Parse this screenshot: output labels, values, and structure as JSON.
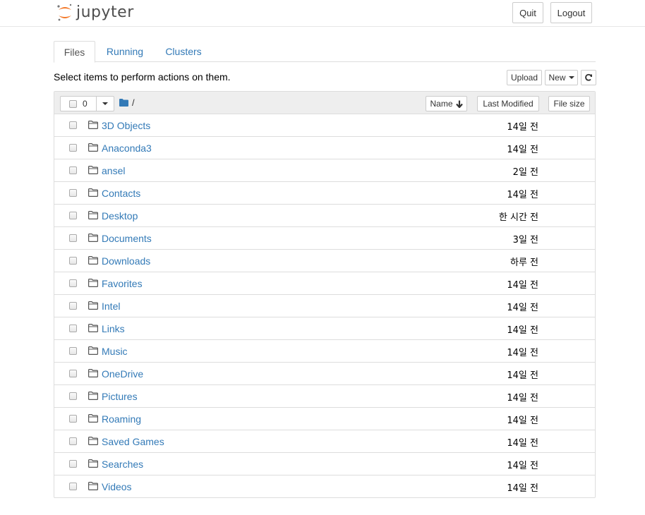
{
  "header": {
    "logo_text": "jupyter",
    "quit_label": "Quit",
    "logout_label": "Logout",
    "accent_color": "#f37726"
  },
  "tabs": [
    {
      "label": "Files",
      "active": true
    },
    {
      "label": "Running",
      "active": false
    },
    {
      "label": "Clusters",
      "active": false
    }
  ],
  "toolbar": {
    "message": "Select items to perform actions on them.",
    "upload_label": "Upload",
    "new_label": "New",
    "refresh_icon": "refresh-icon"
  },
  "list_header": {
    "selected_count": "0",
    "breadcrumb_sep": "/",
    "sort_name_label": "Name",
    "sort_modified_label": "Last Modified",
    "sort_size_label": "File size"
  },
  "files": [
    {
      "name": "3D Objects",
      "modified": "14일 전"
    },
    {
      "name": "Anaconda3",
      "modified": "14일 전"
    },
    {
      "name": "ansel",
      "modified": "2일 전"
    },
    {
      "name": "Contacts",
      "modified": "14일 전"
    },
    {
      "name": "Desktop",
      "modified": "한 시간 전"
    },
    {
      "name": "Documents",
      "modified": "3일 전"
    },
    {
      "name": "Downloads",
      "modified": "하루 전"
    },
    {
      "name": "Favorites",
      "modified": "14일 전"
    },
    {
      "name": "Intel",
      "modified": "14일 전"
    },
    {
      "name": "Links",
      "modified": "14일 전"
    },
    {
      "name": "Music",
      "modified": "14일 전"
    },
    {
      "name": "OneDrive",
      "modified": "14일 전"
    },
    {
      "name": "Pictures",
      "modified": "14일 전"
    },
    {
      "name": "Roaming",
      "modified": "14일 전"
    },
    {
      "name": "Saved Games",
      "modified": "14일 전"
    },
    {
      "name": "Searches",
      "modified": "14일 전"
    },
    {
      "name": "Videos",
      "modified": "14일 전"
    }
  ]
}
